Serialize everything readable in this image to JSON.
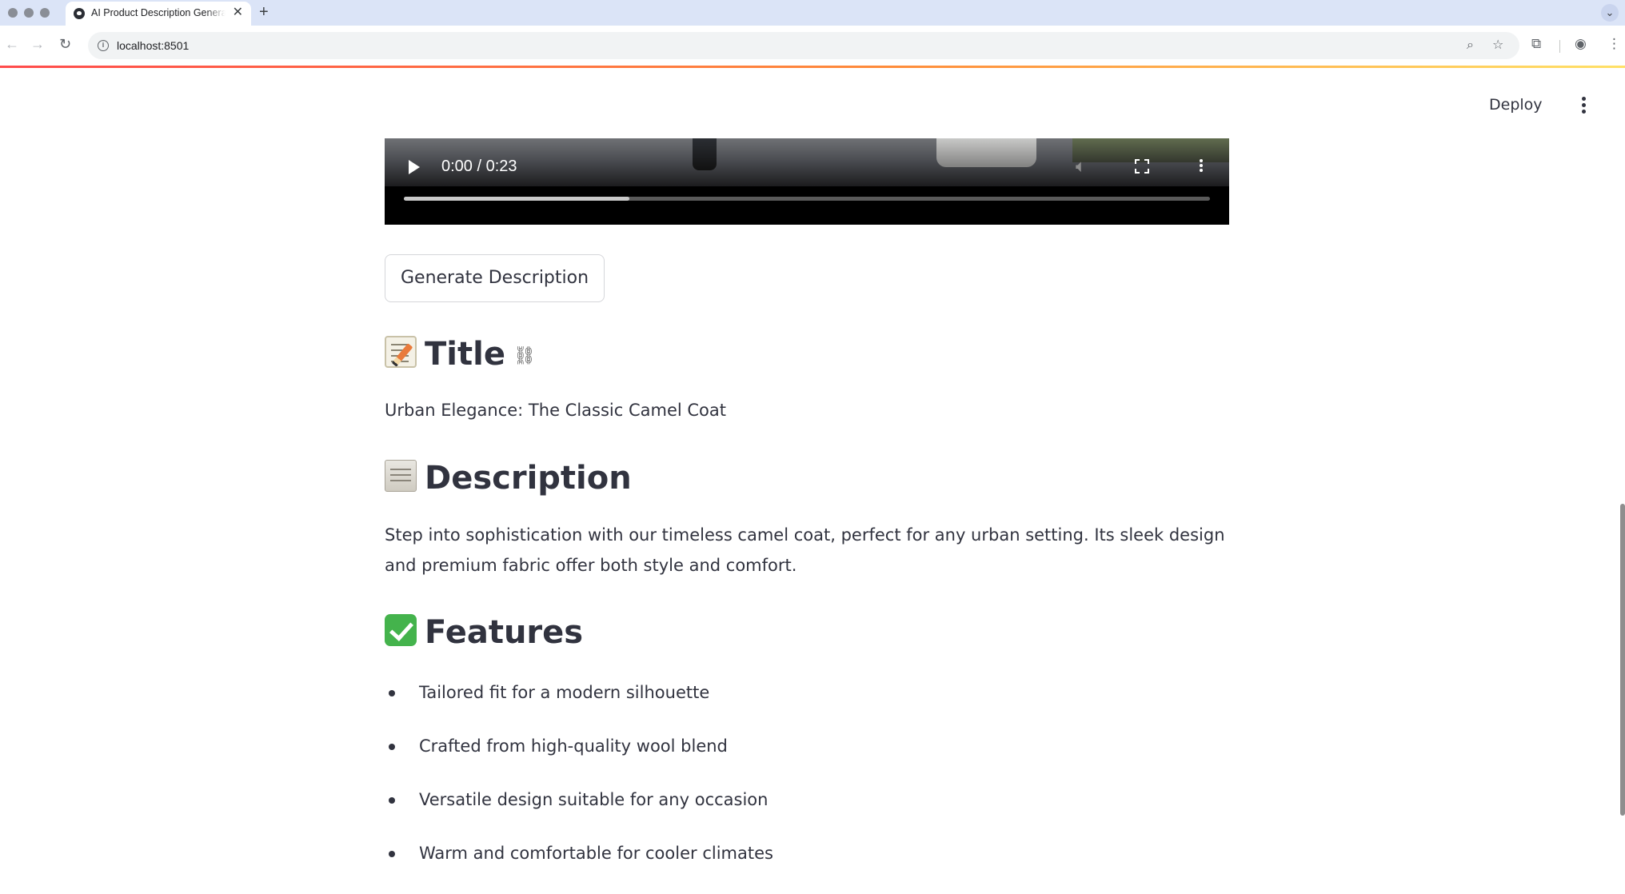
{
  "browser": {
    "tab_title": "AI Product Description Generator",
    "tab_close": "✕",
    "new_tab": "+",
    "url": "localhost:8501",
    "icons": [
      "back-icon",
      "forward-icon",
      "reload-icon",
      "site-info-icon",
      "zoom-icon",
      "bookmark-star-icon",
      "extensions-icon",
      "profile-icon",
      "browser-menu-icon"
    ]
  },
  "app": {
    "deploy_label": "Deploy",
    "video": {
      "time": "0:00 / 0:23",
      "progress_fraction": 0.28
    },
    "generate_button": "Generate Description",
    "title_section": {
      "heading": "Title",
      "emoji": "memo-icon",
      "text": "Urban Elegance: The Classic Camel Coat"
    },
    "description_section": {
      "heading": "Description",
      "emoji": "scroll-icon",
      "text": "Step into sophistication with our timeless camel coat, perfect for any urban setting. Its sleek design and premium fabric offer both style and comfort."
    },
    "features_section": {
      "heading": "Features",
      "emoji": "check-mark-icon",
      "items": [
        "Tailored fit for a modern silhouette",
        "Crafted from high-quality wool blend",
        "Versatile design suitable for any occasion",
        "Warm and comfortable for cooler climates"
      ]
    }
  },
  "colors": {
    "text": "#31333f",
    "accent_gradient_start": "#ff4b4b",
    "accent_gradient_end": "#ffe167",
    "tab_strip": "#dbe4f7"
  }
}
